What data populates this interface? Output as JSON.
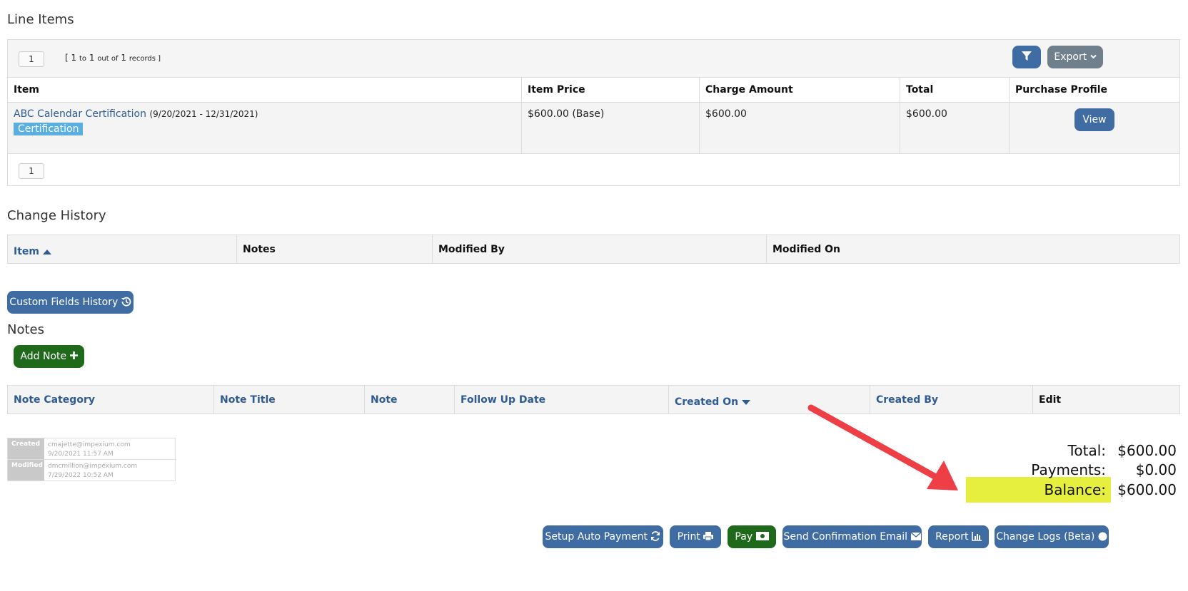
{
  "line_items": {
    "title": "Line Items",
    "page": "1",
    "records_open": "[ 1",
    "records_to": "to",
    "records_mid": "1",
    "records_outof": "out of",
    "records_count": "1",
    "records_close": "records ]",
    "export_label": "Export",
    "columns": [
      "Item",
      "Item Price",
      "Charge Amount",
      "Total",
      "Purchase Profile"
    ],
    "rows": [
      {
        "item_link": "ABC Calendar Certification",
        "item_dates": "(9/20/2021 - 12/31/2021)",
        "tag": "Certification",
        "price": "$600.00 (Base)",
        "charge": "$600.00",
        "total": "$600.00",
        "view_label": "View"
      }
    ],
    "footer_page": "1"
  },
  "change_history": {
    "title": "Change History",
    "columns": [
      "Item",
      "Notes",
      "Modified By",
      "Modified On"
    ]
  },
  "custom_fields_label": "Custom Fields History",
  "notes": {
    "title": "Notes",
    "add_label": "Add Note",
    "columns": [
      "Note Category",
      "Note Title",
      "Note",
      "Follow Up Date",
      "Created On",
      "Created By",
      "Edit"
    ]
  },
  "meta": {
    "created_label": "Created",
    "created_by": "cmajette@impexium.com",
    "created_on": "9/20/2021 11:57 AM",
    "modified_label": "Modified",
    "modified_by": "dmcmillion@impexium.com",
    "modified_on": "7/29/2022 10:52 AM"
  },
  "totals": {
    "total_label": "Total:",
    "total_value": "$600.00",
    "payments_label": "Payments:",
    "payments_value": "$0.00",
    "balance_label": "Balance:",
    "balance_value": "$600.00"
  },
  "actions": {
    "auto_payment": "Setup Auto Payment",
    "print": "Print",
    "pay": "Pay",
    "send_email": "Send Confirmation Email",
    "report": "Report",
    "change_logs": "Change Logs (Beta)"
  },
  "colors": {
    "primary": "#3f6ca3",
    "success": "#1f6a1a",
    "secondary": "#6f7f8c",
    "tag": "#5aaee0",
    "highlight": "#e6ef3e",
    "arrow": "#ee3e46"
  },
  "icons": [
    "filter-icon",
    "chevron-down-icon",
    "sort-up-icon",
    "history-icon",
    "plus-icon",
    "sort-down-icon",
    "refresh-icon",
    "printer-icon",
    "money-icon",
    "envelope-icon",
    "bar-chart-icon",
    "circle-icon"
  ]
}
